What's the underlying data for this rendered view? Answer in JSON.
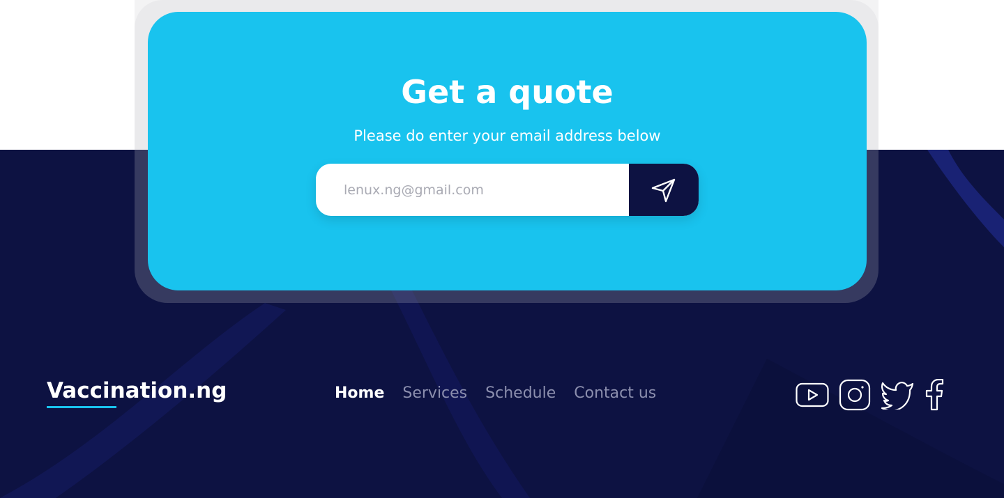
{
  "quote": {
    "title": "Get a quote",
    "subtitle": "Please do enter your email address below",
    "email_placeholder": "lenux.ng@gmail.com"
  },
  "footer": {
    "brand": "Vaccination.ng",
    "nav": [
      {
        "label": "Home",
        "active": true
      },
      {
        "label": "Services",
        "active": false
      },
      {
        "label": "Schedule",
        "active": false
      },
      {
        "label": "Contact us",
        "active": false
      }
    ],
    "social_icons": [
      "youtube-icon",
      "instagram-icon",
      "twitter-icon",
      "facebook-icon"
    ]
  },
  "colors": {
    "accent": "#19c3ee",
    "footer_bg": "#0d1242",
    "nav_inactive": "#8c8fae"
  }
}
